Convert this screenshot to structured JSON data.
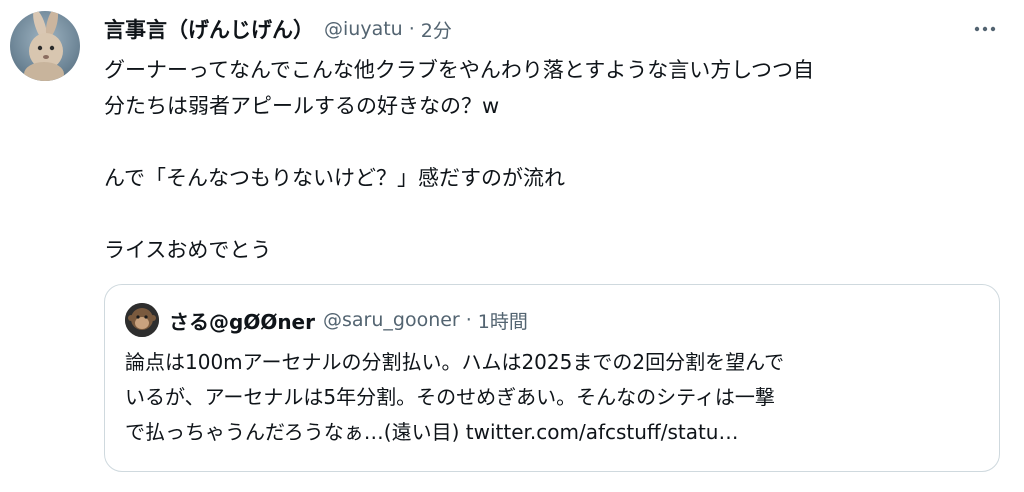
{
  "tweet": {
    "author_name": "言事言（げんじげん）",
    "handle": "@iuyatu",
    "separator": "·",
    "time": "2分",
    "more_icon": "more-horizontal-icon",
    "lines": [
      "グーナーってなんでこんな他クラブをやんわり落とすような言い方しつつ自",
      "分たちは弱者アピールするの好きなの？w",
      "",
      "んで「そんなつもりないけど？」感だすのが流れ",
      "",
      "ライスおめでとう"
    ]
  },
  "quoted": {
    "author_name": "さる@gØØner",
    "handle": "@saru_gooner",
    "separator": "·",
    "time": "1時間",
    "lines": [
      "論点は100mアーセナルの分割払い。ハムは2025までの2回分割を望んで",
      "いるが、アーセナルは5年分割。そのせめぎあい。そんなのシティは一撃",
      "で払っちゃうんだろうなぁ…(遠い目) twitter.com/afcstuff/statu…"
    ]
  }
}
